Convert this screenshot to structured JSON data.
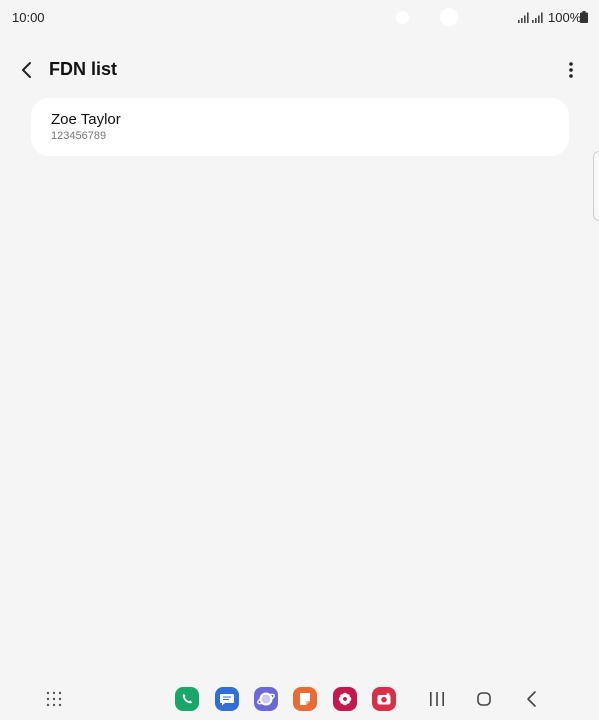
{
  "status_bar": {
    "time": "10:00",
    "battery": "100%",
    "icons": [
      "signal-icon",
      "signal-icon",
      "battery-icon"
    ]
  },
  "header": {
    "title": "FDN list",
    "back_icon": "back-chevron-icon",
    "more_icon": "more-vertical-icon"
  },
  "contacts": [
    {
      "name": "Zoe Taylor",
      "number": "123456789"
    }
  ],
  "bottom_bar": {
    "apps_icon": "apps-grid-icon",
    "dock": [
      {
        "name": "phone-app-icon",
        "color": "#1aa56a"
      },
      {
        "name": "messages-app-icon",
        "color": "#2f6fd6"
      },
      {
        "name": "internet-app-icon",
        "color": "#6d68d8"
      },
      {
        "name": "notes-app-icon",
        "color": "#ea6a33"
      },
      {
        "name": "bixby-app-icon",
        "color": "#c4194f"
      },
      {
        "name": "camera-app-icon",
        "color": "#d9304a"
      }
    ],
    "nav": [
      "recents-icon",
      "home-icon",
      "back-icon"
    ]
  },
  "colors": {
    "background": "#f5f5f5",
    "card": "#ffffff",
    "title": "#111111",
    "secondary_text": "#777777"
  }
}
